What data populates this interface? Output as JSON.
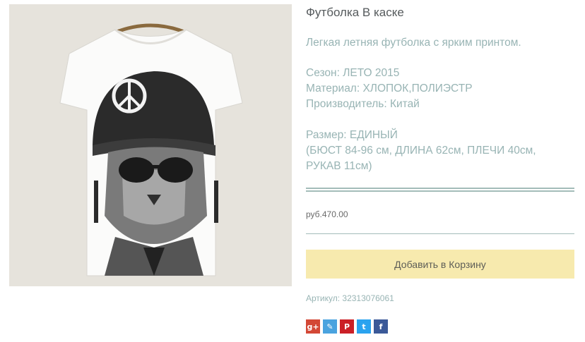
{
  "product": {
    "title": "Футболка В каске",
    "description": "Легкая летняя футболка с ярким принтом.",
    "season": "Сезон: ЛЕТО 2015",
    "material": "Материал: ХЛОПОК,ПОЛИЭСТР",
    "manufacturer": "Производитель: Китай",
    "size": "Размер: ЕДИНЫЙ",
    "measurements_line1": "(БЮСТ 84-96 см, ДЛИНА 62см, ПЛЕЧИ 40см,",
    "measurements_line2": "РУКАВ 11см)",
    "price": "руб.470.00",
    "add_to_cart_label": "Добавить в Корзину",
    "sku": "Артикул: 32313076061"
  },
  "share": [
    {
      "name": "google-plus",
      "glyph": "g+",
      "color": "#d34836"
    },
    {
      "name": "livejournal",
      "glyph": "✎",
      "color": "#4aa3df"
    },
    {
      "name": "pinterest",
      "glyph": "P",
      "color": "#cb2027"
    },
    {
      "name": "twitter",
      "glyph": "t",
      "color": "#2aa3ef"
    },
    {
      "name": "facebook",
      "glyph": "f",
      "color": "#3b5998"
    }
  ],
  "colors": {
    "accent_text": "#98b4b4",
    "rule": "#a3bcb9",
    "button_bg": "#f7eaae"
  }
}
